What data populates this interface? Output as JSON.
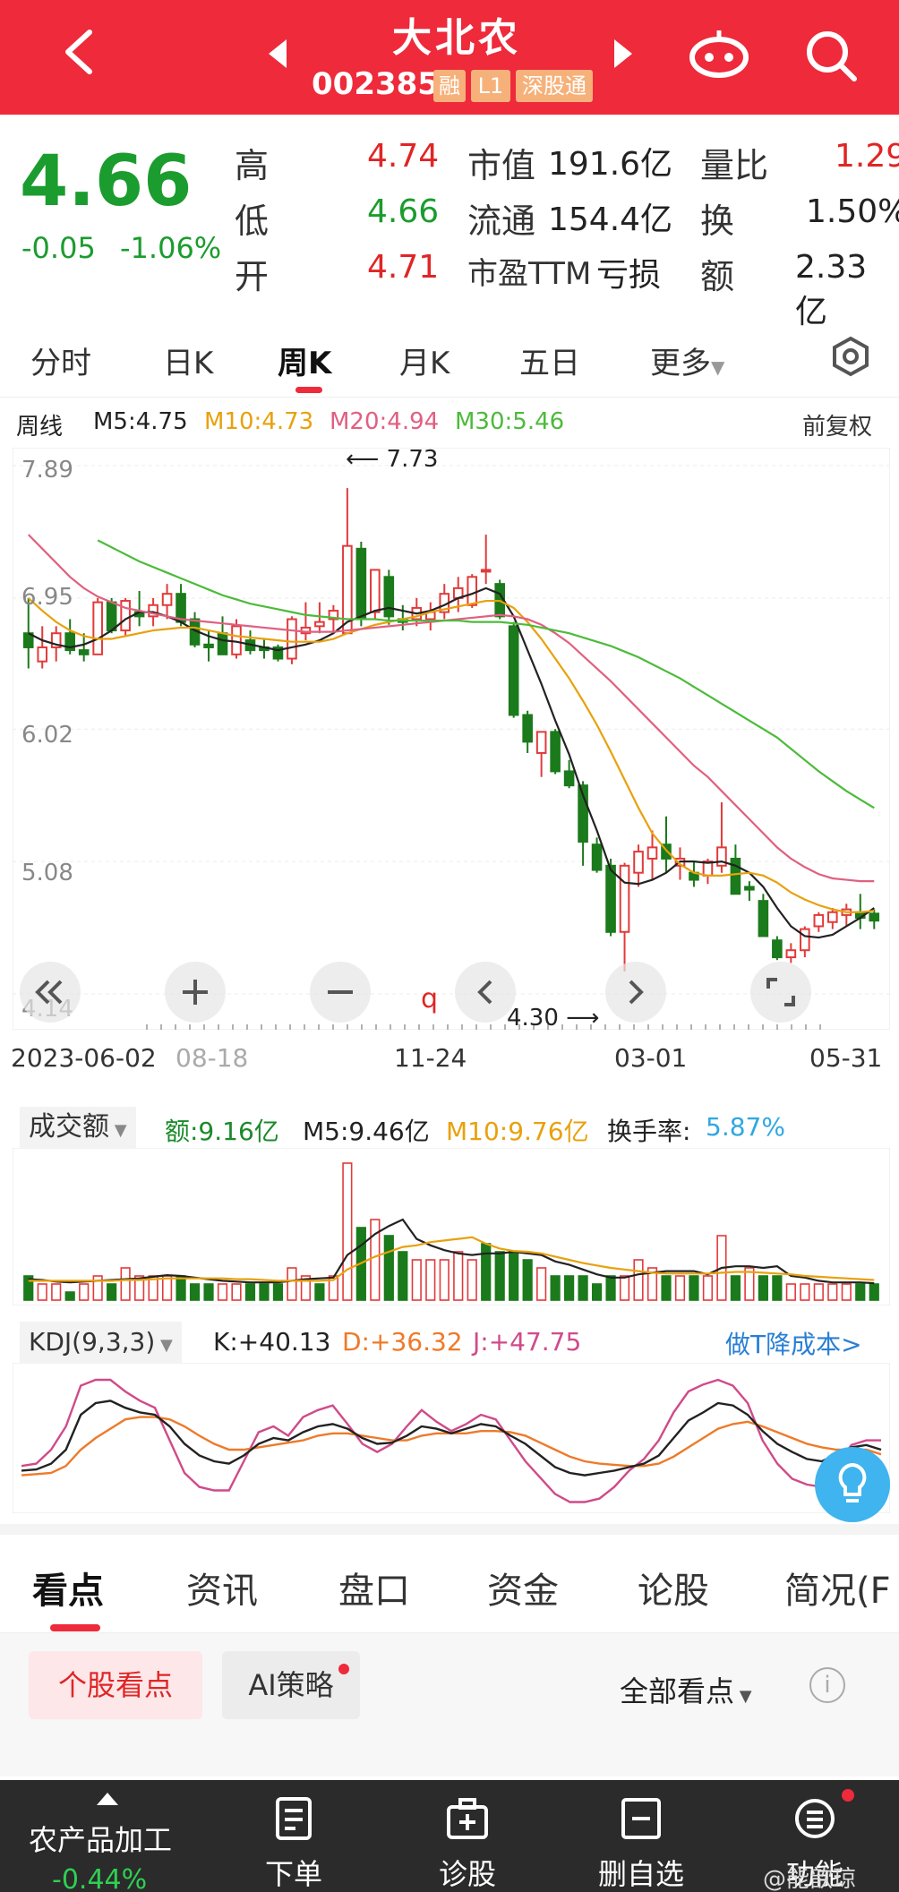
{
  "header": {
    "stock_name": "大北农",
    "stock_code": "002385",
    "tags": [
      "融",
      "L1",
      "深股通"
    ],
    "bg_color": "#ee2a3b"
  },
  "quote": {
    "price": "4.66",
    "change": "-0.05",
    "change_pct": "-1.06%",
    "high_label": "高",
    "high": "4.74",
    "low_label": "低",
    "low": "4.66",
    "open_label": "开",
    "open": "4.71",
    "mktcap_label": "市值",
    "mktcap": "191.6亿",
    "float_label": "流通",
    "float": "154.4亿",
    "pe_label": "市盈TTM",
    "pe": "亏损",
    "volratio_label": "量比",
    "volratio": "1.29",
    "turnover_label": "换",
    "turnover": "1.50%",
    "amount_label": "额",
    "amount": "2.33亿"
  },
  "period_tabs": [
    "分时",
    "日K",
    "周K",
    "月K",
    "五日",
    "更多"
  ],
  "active_period": "周K",
  "ma_legend": {
    "period": "周线",
    "m5": "M5:4.75",
    "m10": "M10:4.73",
    "m20": "M20:4.94",
    "m30": "M30:5.46",
    "adjust": "前复权",
    "colors": {
      "m5": "#222222",
      "m10": "#e8a10d",
      "m20": "#e06080",
      "m30": "#4cbb3a"
    }
  },
  "chart_data": [
    {
      "type": "candlestick",
      "title": "",
      "yticks": [
        "7.89",
        "6.95",
        "6.02",
        "5.08",
        "4.14"
      ],
      "ylim": [
        4.14,
        7.89
      ],
      "xticks": [
        "2023-06-02",
        "08-18",
        "11-24",
        "03-01",
        "05-31"
      ],
      "annotations": [
        "7.73",
        "4.30",
        "q"
      ],
      "candles": [
        [
          6.7,
          6.95,
          6.45,
          6.6
        ],
        [
          6.5,
          6.75,
          6.45,
          6.6
        ],
        [
          6.6,
          6.75,
          6.5,
          6.7
        ],
        [
          6.7,
          6.8,
          6.55,
          6.58
        ],
        [
          6.58,
          6.7,
          6.5,
          6.55
        ],
        [
          6.55,
          6.95,
          6.55,
          6.92
        ],
        [
          6.92,
          6.95,
          6.7,
          6.72
        ],
        [
          6.72,
          6.95,
          6.68,
          6.93
        ],
        [
          6.85,
          7.0,
          6.75,
          6.82
        ],
        [
          6.82,
          6.95,
          6.75,
          6.9
        ],
        [
          6.9,
          7.05,
          6.8,
          6.98
        ],
        [
          6.98,
          7.05,
          6.75,
          6.78
        ],
        [
          6.8,
          6.85,
          6.6,
          6.62
        ],
        [
          6.62,
          6.72,
          6.5,
          6.6
        ],
        [
          6.7,
          6.82,
          6.55,
          6.55
        ],
        [
          6.55,
          6.8,
          6.52,
          6.75
        ],
        [
          6.65,
          6.72,
          6.55,
          6.58
        ],
        [
          6.6,
          6.66,
          6.52,
          6.58
        ],
        [
          6.6,
          6.62,
          6.5,
          6.52
        ],
        [
          6.52,
          6.82,
          6.48,
          6.8
        ],
        [
          6.7,
          6.92,
          6.65,
          6.74
        ],
        [
          6.75,
          6.92,
          6.7,
          6.78
        ],
        [
          6.8,
          6.9,
          6.7,
          6.86
        ],
        [
          6.7,
          7.73,
          6.7,
          7.32
        ],
        [
          7.3,
          7.35,
          6.75,
          6.8
        ],
        [
          6.85,
          7.15,
          6.8,
          7.15
        ],
        [
          7.1,
          7.15,
          6.76,
          6.82
        ],
        [
          6.8,
          6.9,
          6.72,
          6.78
        ],
        [
          6.8,
          6.95,
          6.75,
          6.88
        ],
        [
          6.8,
          6.92,
          6.72,
          6.85
        ],
        [
          6.85,
          7.05,
          6.8,
          6.98
        ],
        [
          6.95,
          7.1,
          6.85,
          7.02
        ],
        [
          6.9,
          7.12,
          6.88,
          7.1
        ],
        [
          7.15,
          7.4,
          7.05,
          7.15
        ],
        [
          7.05,
          7.08,
          6.8,
          6.82
        ],
        [
          6.75,
          6.78,
          6.1,
          6.12
        ],
        [
          6.12,
          6.15,
          5.85,
          5.93
        ],
        [
          5.85,
          6.0,
          5.68,
          6.0
        ],
        [
          6.0,
          6.02,
          5.7,
          5.72
        ],
        [
          5.72,
          5.8,
          5.6,
          5.62
        ],
        [
          5.62,
          5.65,
          5.05,
          5.22
        ],
        [
          5.2,
          5.25,
          5.0,
          5.02
        ],
        [
          5.05,
          5.1,
          4.55,
          4.58
        ],
        [
          4.58,
          5.07,
          4.3,
          5.05
        ],
        [
          5.0,
          5.2,
          4.9,
          5.15
        ],
        [
          5.1,
          5.3,
          4.95,
          5.18
        ],
        [
          5.2,
          5.4,
          5.0,
          5.1
        ],
        [
          5.05,
          5.18,
          4.95,
          5.1
        ],
        [
          5.0,
          5.08,
          4.9,
          4.95
        ],
        [
          4.98,
          5.1,
          4.92,
          5.08
        ],
        [
          5.05,
          5.5,
          5.0,
          5.18
        ],
        [
          5.1,
          5.2,
          4.85,
          4.85
        ],
        [
          4.9,
          4.94,
          4.8,
          4.88
        ],
        [
          4.8,
          4.85,
          4.55,
          4.55
        ],
        [
          4.52,
          4.55,
          4.38,
          4.4
        ],
        [
          4.4,
          4.5,
          4.36,
          4.45
        ],
        [
          4.45,
          4.62,
          4.4,
          4.6
        ],
        [
          4.62,
          4.72,
          4.58,
          4.7
        ],
        [
          4.65,
          4.75,
          4.6,
          4.72
        ],
        [
          4.7,
          4.78,
          4.62,
          4.74
        ],
        [
          4.72,
          4.85,
          4.6,
          4.68
        ],
        [
          4.71,
          4.74,
          4.6,
          4.66
        ]
      ],
      "ma": {
        "M5": [
          6.7,
          6.65,
          6.62,
          6.6,
          6.62,
          6.66,
          6.72,
          6.8,
          6.85,
          6.85,
          6.82,
          6.78,
          6.72,
          6.68,
          6.65,
          6.64,
          6.62,
          6.6,
          6.58,
          6.6,
          6.62,
          6.65,
          6.7,
          6.78,
          6.82,
          6.86,
          6.88,
          6.86,
          6.84,
          6.86,
          6.9,
          6.95,
          6.98,
          7.02,
          6.98,
          6.82,
          6.58,
          6.34,
          6.08,
          5.84,
          5.55,
          5.3,
          5.02,
          4.93,
          4.92,
          4.95,
          5.0,
          5.08,
          5.08,
          5.07,
          5.08,
          5.05,
          5.0,
          4.9,
          4.75,
          4.62,
          4.55,
          4.54,
          4.56,
          4.62,
          4.68,
          4.75
        ],
        "M10": [
          6.95,
          6.86,
          6.78,
          6.72,
          6.68,
          6.66,
          6.66,
          6.68,
          6.7,
          6.72,
          6.73,
          6.74,
          6.74,
          6.72,
          6.7,
          6.68,
          6.67,
          6.66,
          6.65,
          6.64,
          6.64,
          6.64,
          6.66,
          6.7,
          6.73,
          6.76,
          6.78,
          6.8,
          6.82,
          6.85,
          6.87,
          6.89,
          6.91,
          6.93,
          6.93,
          6.88,
          6.78,
          6.66,
          6.52,
          6.38,
          6.22,
          6.05,
          5.86,
          5.66,
          5.46,
          5.28,
          5.16,
          5.06,
          5.0,
          4.98,
          4.98,
          4.99,
          5.0,
          4.98,
          4.93,
          4.86,
          4.81,
          4.77,
          4.74,
          4.72,
          4.72,
          4.73
        ],
        "M20": [
          7.4,
          7.3,
          7.2,
          7.1,
          7.02,
          6.96,
          6.92,
          6.88,
          6.86,
          6.84,
          6.82,
          6.8,
          6.79,
          6.78,
          6.77,
          6.76,
          6.75,
          6.74,
          6.73,
          6.72,
          6.71,
          6.71,
          6.71,
          6.72,
          6.73,
          6.74,
          6.75,
          6.76,
          6.77,
          6.78,
          6.79,
          6.8,
          6.81,
          6.82,
          6.83,
          6.82,
          6.8,
          6.76,
          6.7,
          6.63,
          6.54,
          6.45,
          6.36,
          6.26,
          6.16,
          6.06,
          5.96,
          5.86,
          5.76,
          5.68,
          5.58,
          5.48,
          5.38,
          5.28,
          5.18,
          5.1,
          5.04,
          4.99,
          4.96,
          4.95,
          4.94,
          4.94
        ],
        "M30": [
          7.7,
          7.62,
          7.55,
          7.48,
          7.42,
          7.36,
          7.31,
          7.26,
          7.21,
          7.17,
          7.13,
          7.09,
          7.05,
          7.01,
          6.97,
          6.94,
          6.91,
          6.89,
          6.87,
          6.85,
          6.83,
          6.82,
          6.81,
          6.8,
          6.8,
          6.8,
          6.79,
          6.79,
          6.79,
          6.79,
          6.79,
          6.79,
          6.78,
          6.78,
          6.78,
          6.77,
          6.76,
          6.74,
          6.72,
          6.7,
          6.67,
          6.64,
          6.61,
          6.57,
          6.53,
          6.48,
          6.43,
          6.38,
          6.32,
          6.26,
          6.2,
          6.14,
          6.08,
          6.02,
          5.96,
          5.88,
          5.8,
          5.72,
          5.65,
          5.58,
          5.52,
          5.46
        ]
      }
    },
    {
      "type": "bar",
      "title": "成交额",
      "series_labels": {
        "amount": "额:9.16亿",
        "m5": "M5:9.46亿",
        "m10": "M10:9.76亿",
        "turnover": "换手率:5.87%"
      },
      "values": [
        3,
        2,
        2,
        1,
        2,
        3,
        2,
        4,
        3,
        3,
        3,
        3,
        2,
        2,
        2,
        2,
        2,
        2,
        2,
        4,
        3,
        2,
        3,
        17,
        9,
        10,
        8,
        6,
        5,
        5,
        5,
        6,
        5,
        7,
        6,
        6,
        5,
        4,
        3,
        3,
        3,
        2,
        3,
        3,
        5,
        4,
        3,
        3,
        3,
        3,
        8,
        3,
        4,
        3,
        3,
        2,
        2,
        2,
        2,
        2,
        2,
        2
      ],
      "up": [
        false,
        true,
        true,
        false,
        true,
        true,
        false,
        true,
        true,
        true,
        true,
        false,
        false,
        false,
        true,
        true,
        false,
        false,
        false,
        true,
        true,
        false,
        true,
        true,
        false,
        true,
        false,
        false,
        true,
        true,
        true,
        true,
        true,
        false,
        false,
        false,
        false,
        true,
        false,
        false,
        false,
        false,
        false,
        true,
        true,
        true,
        false,
        true,
        false,
        true,
        true,
        false,
        true,
        false,
        false,
        true,
        true,
        true,
        true,
        true,
        false,
        false
      ],
      "m5": [
        2.6,
        2.5,
        2.3,
        2.2,
        2.3,
        2.4,
        2.5,
        2.6,
        2.7,
        2.9,
        3.1,
        3.0,
        2.8,
        2.6,
        2.4,
        2.3,
        2.2,
        2.2,
        2.2,
        2.4,
        2.6,
        2.7,
        2.8,
        5.6,
        6.8,
        8.2,
        9.2,
        10.0,
        7.6,
        6.8,
        6.2,
        5.8,
        5.6,
        5.8,
        5.8,
        6.0,
        5.8,
        5.6,
        4.8,
        4.4,
        3.8,
        3.2,
        2.8,
        2.8,
        3.2,
        3.4,
        3.6,
        3.6,
        3.6,
        3.2,
        4.0,
        4.2,
        4.2,
        4.0,
        4.2,
        3.0,
        2.8,
        2.4,
        2.2,
        2.2,
        2.2,
        2.1
      ],
      "m10": [
        2.4,
        2.4,
        2.4,
        2.4,
        2.4,
        2.4,
        2.4,
        2.5,
        2.5,
        2.6,
        2.7,
        2.7,
        2.7,
        2.7,
        2.7,
        2.6,
        2.6,
        2.5,
        2.4,
        2.4,
        2.4,
        2.4,
        2.5,
        3.8,
        4.6,
        5.4,
        6.0,
        6.6,
        6.8,
        7.2,
        7.4,
        7.6,
        7.8,
        7.0,
        6.4,
        6.1,
        6.0,
        5.8,
        5.4,
        5.0,
        4.6,
        4.3,
        4.0,
        3.8,
        3.6,
        3.4,
        3.3,
        3.3,
        3.3,
        3.3,
        3.4,
        3.5,
        3.5,
        3.4,
        3.3,
        3.2,
        3.0,
        2.9,
        2.8,
        2.7,
        2.6,
        2.5
      ]
    },
    {
      "type": "line",
      "title": "KDJ(9,3,3)",
      "series_labels": {
        "k": "K:+40.13",
        "d": "D:+36.32",
        "j": "J:+47.75"
      },
      "colors": {
        "k": "#222222",
        "d": "#ee7a2a",
        "j": "#d04a8a"
      },
      "ylim": [
        -10,
        110
      ],
      "k": [
        22,
        23,
        28,
        40,
        70,
        80,
        82,
        76,
        72,
        70,
        60,
        45,
        35,
        30,
        28,
        35,
        45,
        50,
        48,
        55,
        60,
        62,
        58,
        50,
        45,
        46,
        52,
        60,
        58,
        54,
        58,
        62,
        60,
        52,
        45,
        35,
        25,
        20,
        18,
        20,
        22,
        25,
        28,
        35,
        50,
        65,
        72,
        80,
        78,
        70,
        56,
        45,
        38,
        32,
        30,
        36,
        42,
        44,
        40
      ],
      "d": [
        18,
        19,
        20,
        26,
        40,
        50,
        58,
        66,
        68,
        68,
        66,
        60,
        52,
        45,
        40,
        40,
        42,
        44,
        46,
        48,
        52,
        54,
        54,
        52,
        50,
        48,
        48,
        52,
        54,
        54,
        54,
        56,
        56,
        55,
        52,
        46,
        40,
        34,
        30,
        28,
        27,
        26,
        26,
        28,
        34,
        42,
        50,
        58,
        62,
        64,
        60,
        55,
        50,
        45,
        42,
        40,
        40,
        40,
        36
      ],
      "j": [
        26,
        28,
        40,
        60,
        95,
        100,
        100,
        90,
        82,
        76,
        48,
        20,
        8,
        5,
        5,
        30,
        55,
        60,
        52,
        68,
        74,
        78,
        62,
        45,
        38,
        45,
        60,
        74,
        64,
        56,
        62,
        70,
        66,
        48,
        30,
        16,
        2,
        -5,
        -5,
        -2,
        8,
        22,
        32,
        48,
        72,
        90,
        96,
        100,
        95,
        80,
        48,
        28,
        15,
        10,
        8,
        28,
        44,
        48,
        48
      ]
    }
  ],
  "volume_panel": {
    "selector": "成交额",
    "amount": "额:9.16亿",
    "m5": "M5:9.46亿",
    "m10": "M10:9.76亿",
    "turnover": "换手率:",
    "turnover_value": "5.87%"
  },
  "kdj_panel": {
    "selector": "KDJ(9,3,3)",
    "k": "K:+40.13",
    "d": "D:+36.32",
    "j": "J:+47.75",
    "promo": "做T降成本>"
  },
  "annotations": {
    "high_mark": "7.73",
    "low_mark": "4.30",
    "marker_q": "q"
  },
  "info_tabs": [
    "看点",
    "资讯",
    "盘口",
    "资金",
    "论股",
    "简况(F"
  ],
  "sub_tabs": {
    "chip_gegu": "个股看点",
    "chip_ai": "AI策略",
    "all_points": "全部看点",
    "info_icon": "i"
  },
  "bottom_bar": {
    "sector_name": "农产品加工",
    "sector_chg": "-0.44%",
    "items": [
      "下单",
      "诊股",
      "删自选",
      "功能"
    ]
  },
  "watermark": "@能歆琼"
}
